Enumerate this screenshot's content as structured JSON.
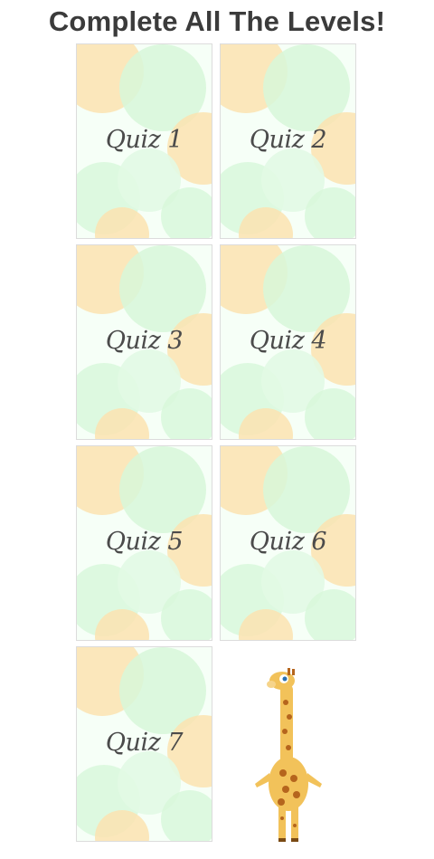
{
  "header": {
    "title": "Complete All The Levels!"
  },
  "levels": [
    {
      "label": "Quiz 1"
    },
    {
      "label": "Quiz 2"
    },
    {
      "label": "Quiz 3"
    },
    {
      "label": "Quiz 4"
    },
    {
      "label": "Quiz 5"
    },
    {
      "label": "Quiz 6"
    },
    {
      "label": "Quiz 7"
    }
  ],
  "colors": {
    "title": "#3b3b3b",
    "card_border": "#dcdcdc",
    "card_orange": "#fbe3b0",
    "card_green": "#d7f7d9",
    "label": "#4b4b4b"
  },
  "mascot": {
    "icon": "giraffe-icon"
  }
}
